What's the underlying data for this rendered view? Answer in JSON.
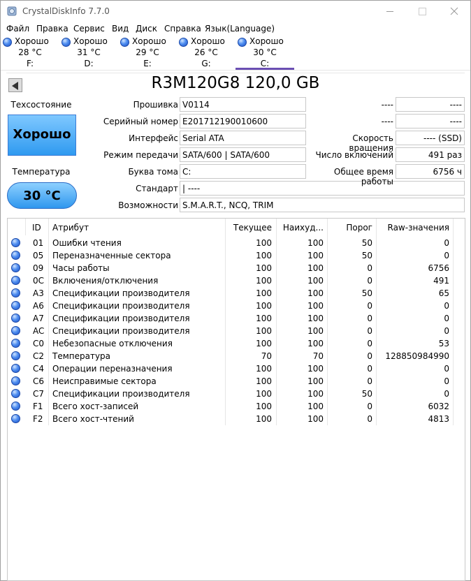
{
  "app": {
    "title": "CrystalDiskInfo 7.7.0"
  },
  "menu": [
    "Файл",
    "Правка",
    "Сервис",
    "Вид",
    "Диск",
    "Справка",
    "Язык(Language)"
  ],
  "drives": [
    {
      "status": "Хорошо",
      "temp": "28 °C",
      "letter": "F:"
    },
    {
      "status": "Хорошо",
      "temp": "31 °C",
      "letter": "D:"
    },
    {
      "status": "Хорошо",
      "temp": "29 °C",
      "letter": "E:"
    },
    {
      "status": "Хорошо",
      "temp": "26 °C",
      "letter": "G:"
    },
    {
      "status": "Хорошо",
      "temp": "30 °C",
      "letter": "C:"
    }
  ],
  "disk": {
    "title": "R3M120G8 120,0 GB",
    "health_label": "Техсостояние",
    "health": "Хорошо",
    "temp_label": "Температура",
    "temp": "30 °C",
    "firmware_label": "Прошивка",
    "firmware": "V0114",
    "serial_label": "Серийный номер",
    "serial": "E201712190010600",
    "interface_label": "Интерфейс",
    "interface": "Serial ATA",
    "transfer_label": "Режим передачи",
    "transfer": "SATA/600 | SATA/600",
    "volume_label": "Буква тома",
    "volume": "C:",
    "standard_label": "Стандарт",
    "standard": "| ----",
    "features_label": "Возможности",
    "features": "S.M.A.R.T., NCQ, TRIM",
    "right_label_1": "----",
    "right_val_1": "----",
    "right_label_2": "----",
    "right_val_2": "----",
    "rotation_label": "Скорость вращения",
    "rotation": "---- (SSD)",
    "power_count_label": "Число включений",
    "power_count": "491 раз",
    "power_hours_label": "Общее время работы",
    "power_hours": "6756 ч"
  },
  "smart": {
    "headers": [
      "ID",
      "Атрибут",
      "Текущее",
      "Наихуд...",
      "Порог",
      "Raw-значения"
    ],
    "rows": [
      [
        "01",
        "Ошибки чтения",
        "100",
        "100",
        "50",
        "0"
      ],
      [
        "05",
        "Переназначенные сектора",
        "100",
        "100",
        "50",
        "0"
      ],
      [
        "09",
        "Часы работы",
        "100",
        "100",
        "0",
        "6756"
      ],
      [
        "0C",
        "Включения/отключения",
        "100",
        "100",
        "0",
        "491"
      ],
      [
        "A3",
        "Спецификации производителя",
        "100",
        "100",
        "50",
        "65"
      ],
      [
        "A6",
        "Спецификации производителя",
        "100",
        "100",
        "0",
        "0"
      ],
      [
        "A7",
        "Спецификации производителя",
        "100",
        "100",
        "0",
        "0"
      ],
      [
        "AC",
        "Спецификации производителя",
        "100",
        "100",
        "0",
        "0"
      ],
      [
        "C0",
        "Небезопасные отключения",
        "100",
        "100",
        "0",
        "53"
      ],
      [
        "C2",
        "Температура",
        "70",
        "70",
        "0",
        "128850984990"
      ],
      [
        "C4",
        "Операции переназначения",
        "100",
        "100",
        "0",
        "0"
      ],
      [
        "C6",
        "Неисправимые сектора",
        "100",
        "100",
        "0",
        "0"
      ],
      [
        "C7",
        "Спецификации производителя",
        "100",
        "100",
        "50",
        "0"
      ],
      [
        "F1",
        "Всего хост-записей",
        "100",
        "100",
        "0",
        "6032"
      ],
      [
        "F2",
        "Всего хост-чтений",
        "100",
        "100",
        "0",
        "4813"
      ]
    ]
  }
}
